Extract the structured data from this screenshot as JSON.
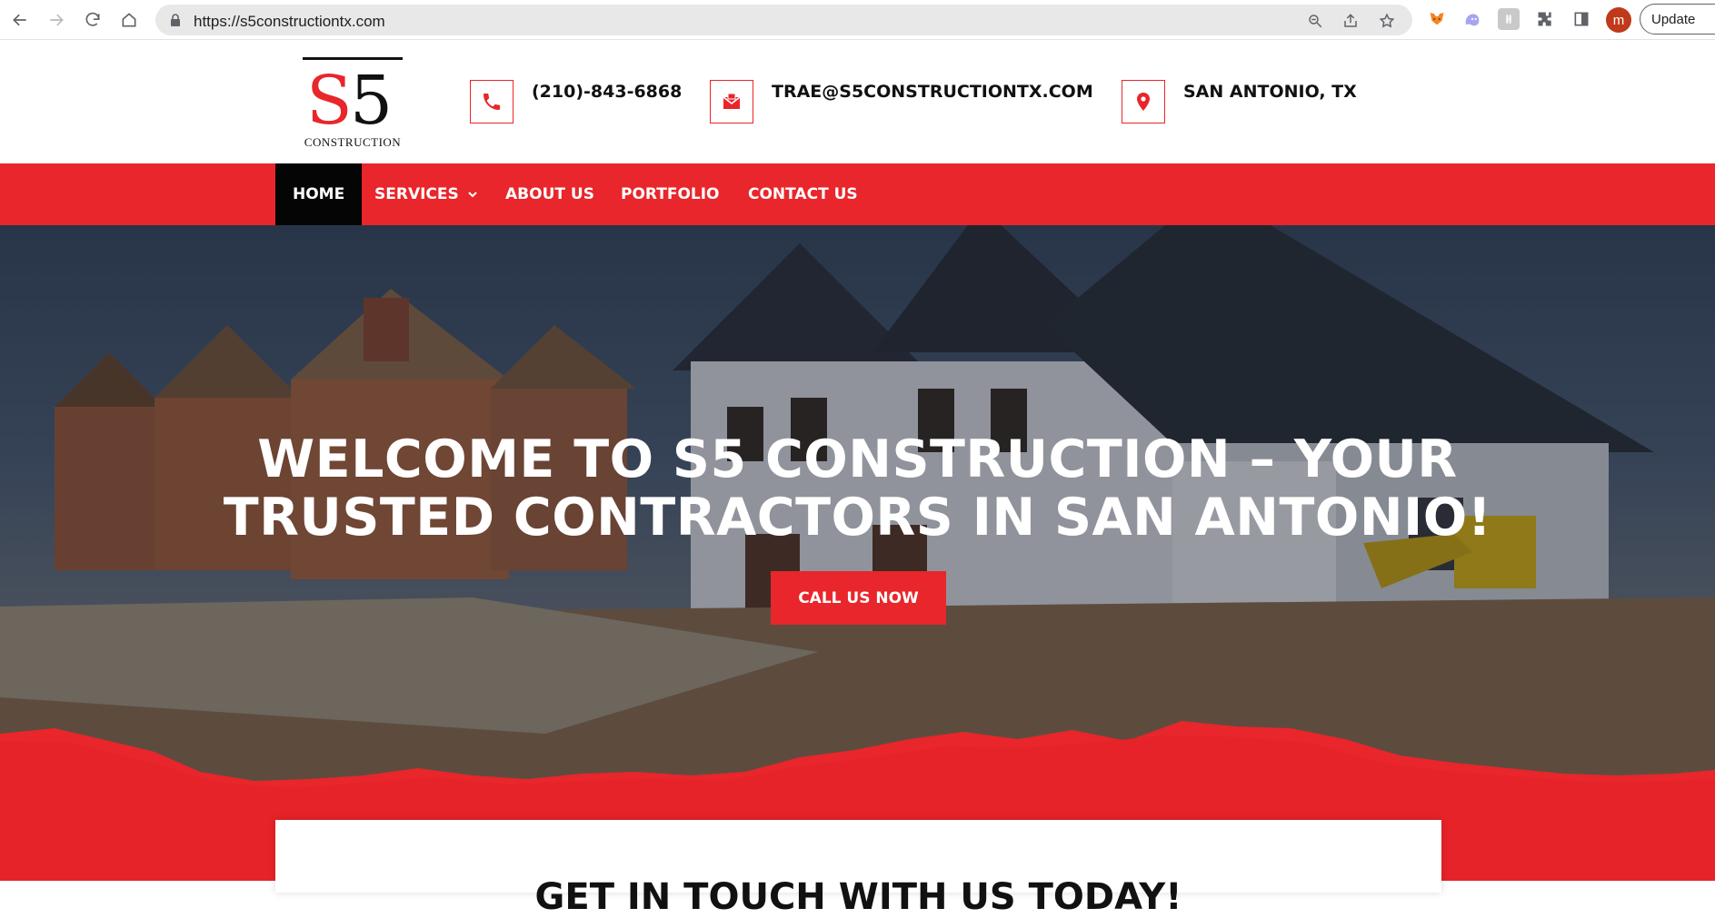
{
  "browser": {
    "url": "https://s5constructiontx.com",
    "profile_initial": "m",
    "update_label": "Update"
  },
  "logo": {
    "s_letter": "S",
    "five": "5",
    "subtitle": "CONSTRUCTION"
  },
  "contact": {
    "phone": "(210)-843-6868",
    "email": "TRAE@S5CONSTRUCTIONTX.COM",
    "location": "SAN ANTONIO, TX"
  },
  "nav": {
    "items": [
      {
        "label": "HOME"
      },
      {
        "label": "SERVICES"
      },
      {
        "label": "ABOUT US"
      },
      {
        "label": "PORTFOLIO"
      },
      {
        "label": "CONTACT US"
      }
    ]
  },
  "hero": {
    "title_line1": "WELCOME TO S5 CONSTRUCTION – YOUR",
    "title_line2": "TRUSTED CONTRACTORS IN SAN ANTONIO!",
    "cta_label": "CALL US NOW"
  },
  "card": {
    "heading": "GET IN TOUCH WITH US TODAY!"
  },
  "colors": {
    "accent": "#e8262b",
    "nav_active": "#050505"
  }
}
